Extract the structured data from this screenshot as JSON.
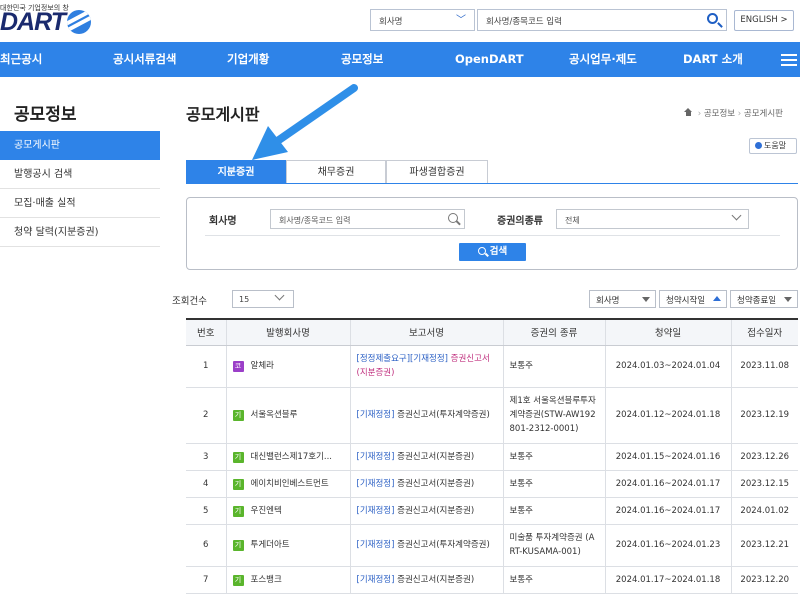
{
  "header": {
    "tagline": "대한민국 기업정보의 창",
    "logo_text": "DART",
    "search_select": "회사명",
    "search_placeholder": "회사명/종목코드 입력",
    "english_label": "ENGLISH >"
  },
  "nav": [
    "최근공시",
    "공시서류검색",
    "기업개황",
    "공모정보",
    "OpenDART",
    "공시업무·제도",
    "DART 소개"
  ],
  "sidebar": {
    "title": "공모정보",
    "items": [
      "공모게시판",
      "발행공시 검색",
      "모집·매출 실적",
      "청약 달력(지분증권)"
    ]
  },
  "main": {
    "title": "공모게시판",
    "breadcrumb": [
      "공모정보",
      "공모게시판"
    ],
    "help_label": "도움말",
    "tabs": [
      "지분증권",
      "채무증권",
      "파생결합증권"
    ]
  },
  "search_panel": {
    "company_label": "회사명",
    "company_placeholder": "회사명/종목코드 입력",
    "security_label": "증권의종류",
    "security_value": "전체",
    "search_button": "검색"
  },
  "list": {
    "count_label": "조회건수",
    "count_value": "15",
    "sort_company": "회사명",
    "sort_start": "청약시작일",
    "sort_end": "청약종료일"
  },
  "colors": {
    "accent": "#2e83e8",
    "badge_kosdaq": "#9b3fc8",
    "badge_kospi": "#5ab52c",
    "report_pink": "#c0317f",
    "report_blue": "#2a5fc4"
  },
  "table": {
    "headers": [
      "번호",
      "발행회사명",
      "보고서명",
      "증권의 종류",
      "청약일",
      "접수일자"
    ],
    "rows": [
      {
        "no": "1",
        "badge": "코",
        "company": "알체라",
        "report_tag": "[정정제출요구][기재정정]",
        "report_name": "증권신고서(지분증권)",
        "security": "보통주",
        "period": "2024.01.03~2024.01.04",
        "date": "2023.11.08"
      },
      {
        "no": "2",
        "badge": "기",
        "company": "서울옥션블루",
        "report_tag": "[기재정정]",
        "report_name": "증권신고서(투자계약증권)",
        "security": "제1호 서울옥션블루투자계약증권(STW-AW192801-2312-0001)",
        "period": "2024.01.12~2024.01.18",
        "date": "2023.12.19"
      },
      {
        "no": "3",
        "badge": "기",
        "company": "대신밸런스제17호기...",
        "report_tag": "[기재정정]",
        "report_name": "증권신고서(지분증권)",
        "security": "보통주",
        "period": "2024.01.15~2024.01.16",
        "date": "2023.12.26"
      },
      {
        "no": "4",
        "badge": "기",
        "company": "에이치비인베스트먼트",
        "report_tag": "[기재정정]",
        "report_name": "증권신고서(지분증권)",
        "security": "보통주",
        "period": "2024.01.16~2024.01.17",
        "date": "2023.12.15"
      },
      {
        "no": "5",
        "badge": "기",
        "company": "우진엔텍",
        "report_tag": "[기재정정]",
        "report_name": "증권신고서(지분증권)",
        "security": "보통주",
        "period": "2024.01.16~2024.01.17",
        "date": "2024.01.02"
      },
      {
        "no": "6",
        "badge": "기",
        "company": "투게더아트",
        "report_tag": "[기재정정]",
        "report_name": "증권신고서(투자계약증권)",
        "security": "미술품 투자계약증권 (ART-KUSAMA-001)",
        "period": "2024.01.16~2024.01.23",
        "date": "2023.12.21"
      },
      {
        "no": "7",
        "badge": "기",
        "company": "포스뱅크",
        "report_tag": "[기재정정]",
        "report_name": "증권신고서(지분증권)",
        "security": "보통주",
        "period": "2024.01.17~2024.01.18",
        "date": "2023.12.20"
      }
    ]
  }
}
